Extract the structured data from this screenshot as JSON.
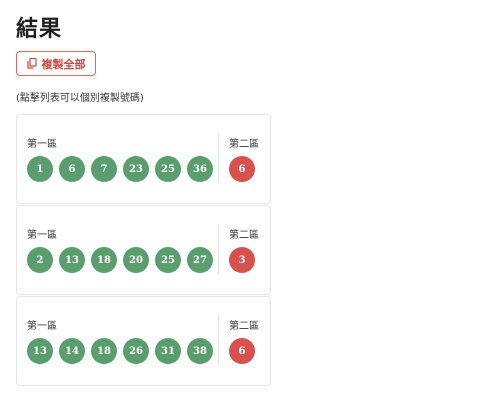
{
  "title": "結果",
  "copy_button": {
    "label": "複製全部",
    "icon": "copy-icon",
    "color": "#c94b43"
  },
  "hint": "(點擊列表可以個別複製號碼)",
  "zone1_label": "第一區",
  "zone2_label": "第二區",
  "colors": {
    "zone1_ball": "#5a9e6e",
    "zone2_ball": "#d9514c"
  },
  "results": [
    {
      "zone1": [
        "1",
        "6",
        "7",
        "23",
        "25",
        "36"
      ],
      "zone2": "6"
    },
    {
      "zone1": [
        "2",
        "13",
        "18",
        "20",
        "25",
        "27"
      ],
      "zone2": "3"
    },
    {
      "zone1": [
        "13",
        "14",
        "18",
        "26",
        "31",
        "38"
      ],
      "zone2": "6"
    }
  ]
}
